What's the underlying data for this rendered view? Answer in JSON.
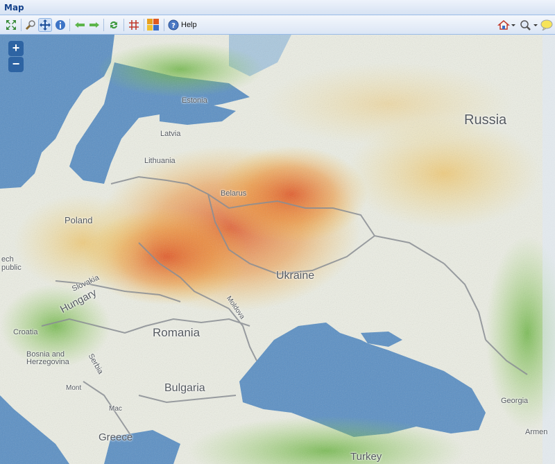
{
  "panel": {
    "title": "Map"
  },
  "toolbar": {
    "help_label": "Help",
    "buttons": [
      "zoom-extent",
      "zoom-magnify",
      "pan",
      "info",
      "back",
      "forward",
      "refresh",
      "grid",
      "layers",
      "help",
      "home-dropdown",
      "search-dropdown",
      "bubble"
    ]
  },
  "zoom": {
    "in_label": "+",
    "out_label": "−"
  },
  "map": {
    "labels": {
      "russia": "Russia",
      "ukraine": "Ukraine",
      "romania": "Romania",
      "bulgaria": "Bulgaria",
      "hungary": "Hungary",
      "poland": "Poland",
      "belarus": "Belarus",
      "lithuania": "Lithuania",
      "latvia": "Latvia",
      "estonia": "Estonia",
      "slovakia": "Slovakia",
      "moldova": "Moldova",
      "croatia": "Croatia",
      "bosnia": "Bosnia and Herzegovina",
      "serbia": "Serbia",
      "montenegro": "Mont",
      "greece": "Greece",
      "turkey": "Turkey",
      "georgia": "Georgia",
      "armenia": "Armen",
      "czech_republic_partial": "ech public",
      "macedonia_partial": "Mac"
    },
    "colors": {
      "water": "#5a8fc4",
      "land": "#eceee4",
      "green": "#6fbf3a",
      "orange": "#f0a030",
      "red": "#e0401a"
    }
  }
}
